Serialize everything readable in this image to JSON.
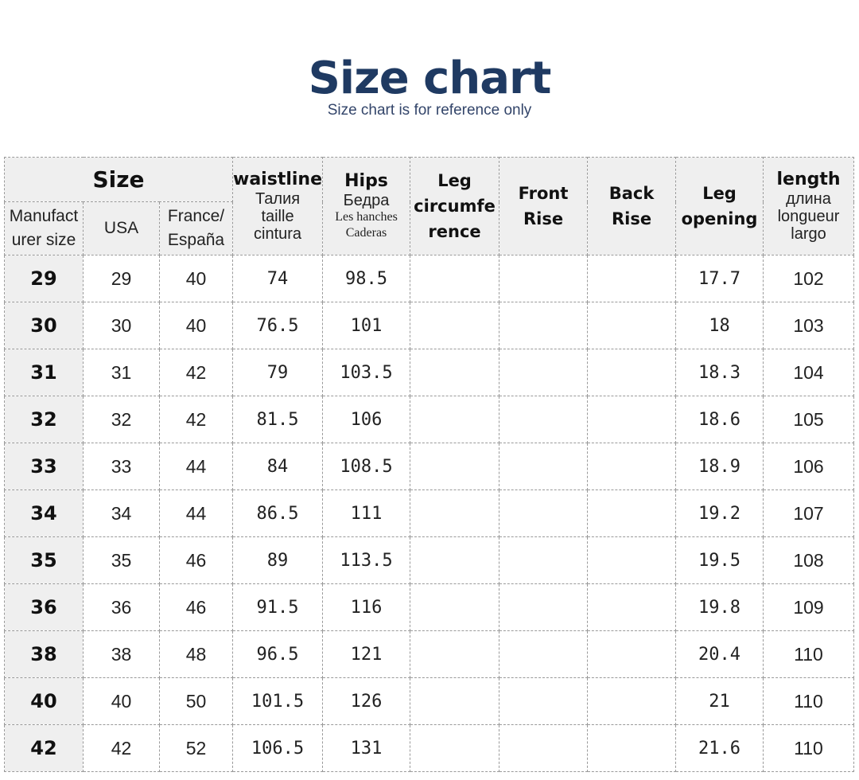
{
  "title": "Size chart",
  "subtitle": "Size chart is for reference only",
  "header": {
    "size_group": "Size",
    "manufacturer_size": "Manufact\nurer size",
    "usa": "USA",
    "france_espana": "France/\nEspaña",
    "waistline": {
      "main": "waistline",
      "sub1": "Талия",
      "sub2": "taille",
      "sub3": "cintura"
    },
    "hips": {
      "main": "Hips",
      "sub1": "Бедра",
      "sub2": "Les hanches",
      "sub3": "Caderas"
    },
    "leg_circumference": "Leg\ncircumfe\nrence",
    "front_rise": "Front\nRise",
    "back_rise": "Back\nRise",
    "leg_opening": "Leg\nopening",
    "length": {
      "main": "length",
      "sub1": "длина",
      "sub2": "longueur",
      "sub3": "largo"
    }
  },
  "rows": [
    {
      "manufacturer": "29",
      "usa": "29",
      "france": "40",
      "waistline": "74",
      "hips": "98.5",
      "leg_circumference": "",
      "front_rise": "",
      "back_rise": "",
      "leg_opening": "17.7",
      "length": "102"
    },
    {
      "manufacturer": "30",
      "usa": "30",
      "france": "40",
      "waistline": "76.5",
      "hips": "101",
      "leg_circumference": "",
      "front_rise": "",
      "back_rise": "",
      "leg_opening": "18",
      "length": "103"
    },
    {
      "manufacturer": "31",
      "usa": "31",
      "france": "42",
      "waistline": "79",
      "hips": "103.5",
      "leg_circumference": "",
      "front_rise": "",
      "back_rise": "",
      "leg_opening": "18.3",
      "length": "104"
    },
    {
      "manufacturer": "32",
      "usa": "32",
      "france": "42",
      "waistline": "81.5",
      "hips": "106",
      "leg_circumference": "",
      "front_rise": "",
      "back_rise": "",
      "leg_opening": "18.6",
      "length": "105"
    },
    {
      "manufacturer": "33",
      "usa": "33",
      "france": "44",
      "waistline": "84",
      "hips": "108.5",
      "leg_circumference": "",
      "front_rise": "",
      "back_rise": "",
      "leg_opening": "18.9",
      "length": "106"
    },
    {
      "manufacturer": "34",
      "usa": "34",
      "france": "44",
      "waistline": "86.5",
      "hips": "111",
      "leg_circumference": "",
      "front_rise": "",
      "back_rise": "",
      "leg_opening": "19.2",
      "length": "107"
    },
    {
      "manufacturer": "35",
      "usa": "35",
      "france": "46",
      "waistline": "89",
      "hips": "113.5",
      "leg_circumference": "",
      "front_rise": "",
      "back_rise": "",
      "leg_opening": "19.5",
      "length": "108"
    },
    {
      "manufacturer": "36",
      "usa": "36",
      "france": "46",
      "waistline": "91.5",
      "hips": "116",
      "leg_circumference": "",
      "front_rise": "",
      "back_rise": "",
      "leg_opening": "19.8",
      "length": "109"
    },
    {
      "manufacturer": "38",
      "usa": "38",
      "france": "48",
      "waistline": "96.5",
      "hips": "121",
      "leg_circumference": "",
      "front_rise": "",
      "back_rise": "",
      "leg_opening": "20.4",
      "length": "110"
    },
    {
      "manufacturer": "40",
      "usa": "40",
      "france": "50",
      "waistline": "101.5",
      "hips": "126",
      "leg_circumference": "",
      "front_rise": "",
      "back_rise": "",
      "leg_opening": "21",
      "length": "110"
    },
    {
      "manufacturer": "42",
      "usa": "42",
      "france": "52",
      "waistline": "106.5",
      "hips": "131",
      "leg_circumference": "",
      "front_rise": "",
      "back_rise": "",
      "leg_opening": "21.6",
      "length": "110"
    }
  ]
}
